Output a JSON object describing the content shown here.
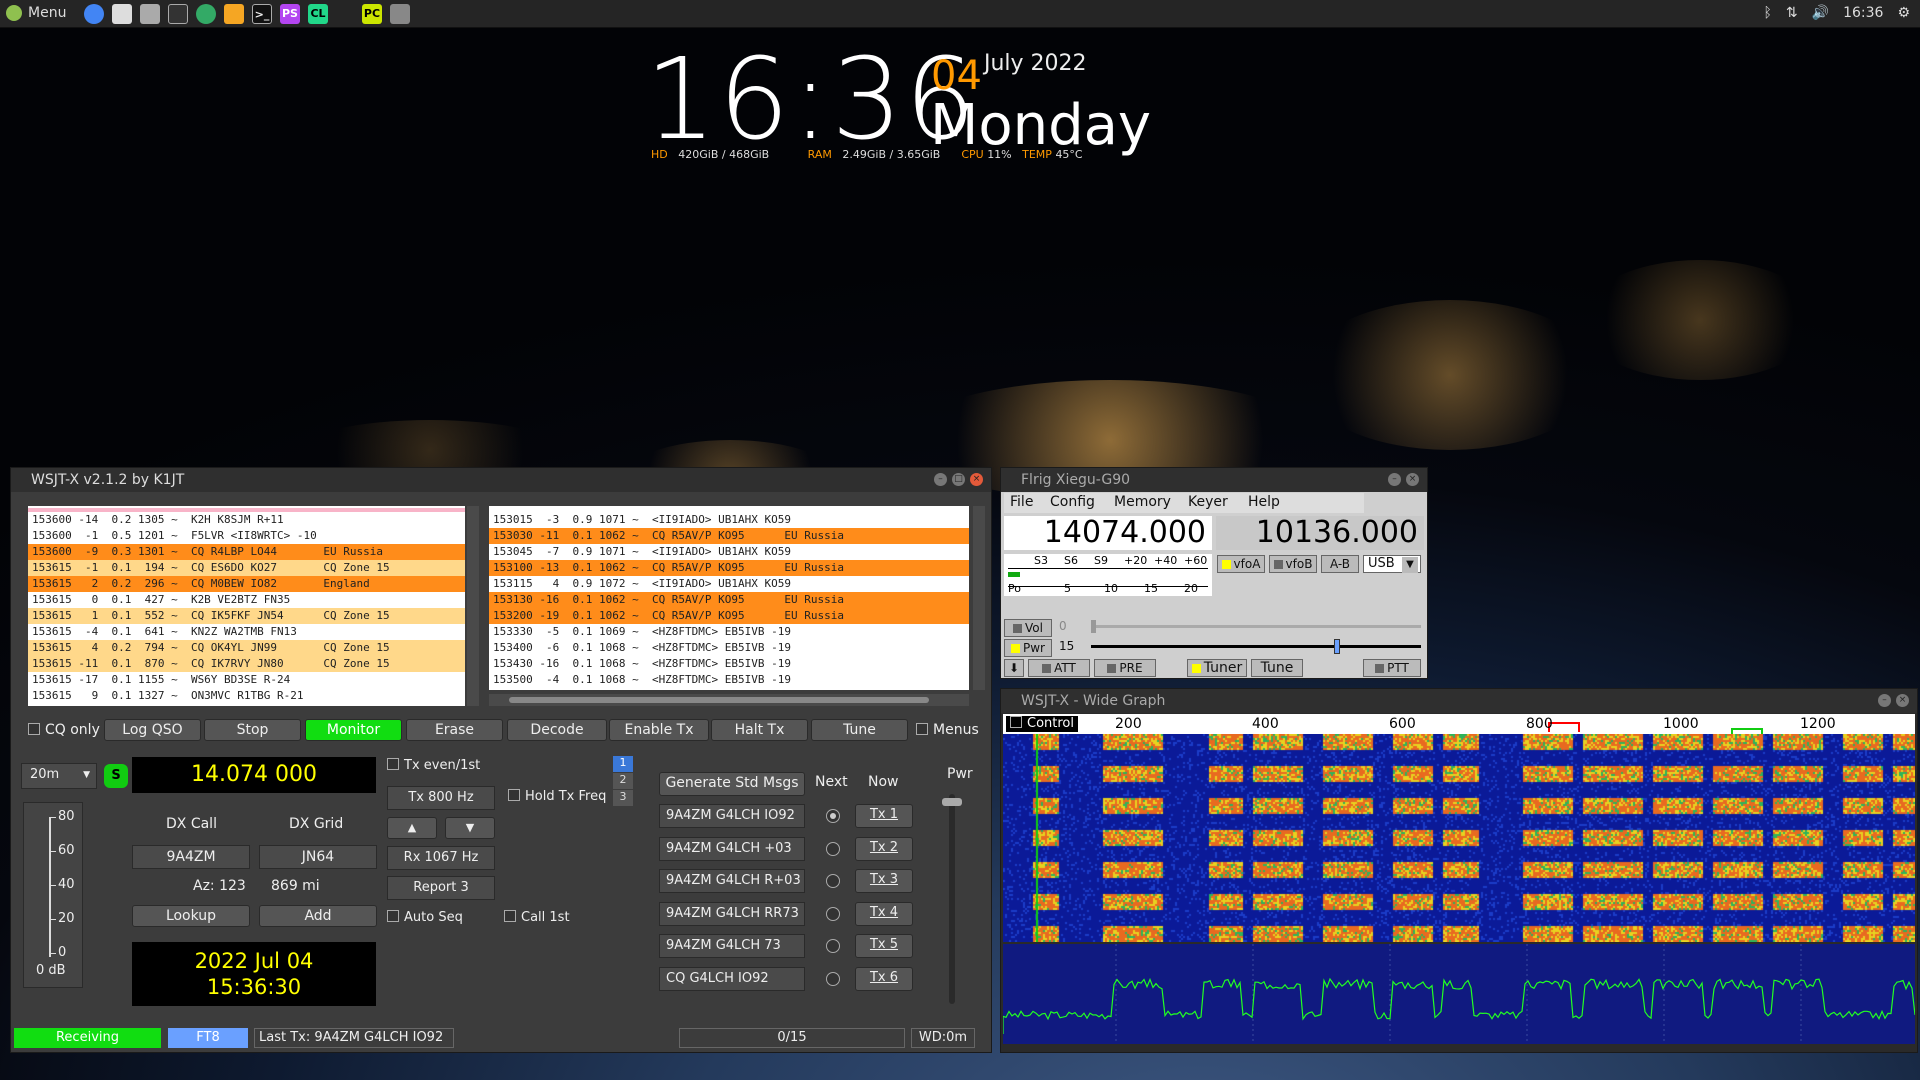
{
  "taskbar": {
    "menu_label": "Menu",
    "clock": "16:36"
  },
  "conky": {
    "time": "16:36",
    "day": "04",
    "month_year": "July 2022",
    "weekday": "Monday",
    "hd_label": "HD",
    "hd_value": "420GiB / 468GiB",
    "ram_label": "RAM",
    "ram_value": "2.49GiB / 3.65GiB",
    "cpu_label": "CPU",
    "cpu_value": "11%",
    "temp_label": "TEMP",
    "temp_value": "45°C"
  },
  "wsjtx": {
    "title": "WSJT-X  v2.1.2  by K1JT",
    "band_activity": [
      {
        "text": "153600 -14  0.2 1305 ~  K2H K8SJM R+11",
        "hl": ""
      },
      {
        "text": "153600  -1  0.5 1201 ~  F5LVR <II8WRTC> -10",
        "hl": ""
      },
      {
        "text": "153600  -9  0.3 1301 ~  CQ R4LBP LO44       EU Russia",
        "hl": "orange"
      },
      {
        "text": "153615  -1  0.1  194 ~  CQ ES6DO KO27       CQ Zone 15",
        "hl": "yellow"
      },
      {
        "text": "153615   2  0.2  296 ~  CQ M0BEW IO82       England",
        "hl": "orange"
      },
      {
        "text": "153615   0  0.1  427 ~  K2B VE2BTZ FN35",
        "hl": ""
      },
      {
        "text": "153615   1  0.1  552 ~  CQ IK5FKF JN54      CQ Zone 15",
        "hl": "yellow"
      },
      {
        "text": "153615  -4  0.1  641 ~  KN2Z WA2TMB FN13",
        "hl": ""
      },
      {
        "text": "153615   4  0.2  794 ~  CQ OK4YL JN99       CQ Zone 15",
        "hl": "yellow"
      },
      {
        "text": "153615 -11  0.1  870 ~  CQ IK7RVY JN80      CQ Zone 15",
        "hl": "yellow"
      },
      {
        "text": "153615 -17  0.1 1155 ~  WS6Y BD3SE R-24",
        "hl": ""
      },
      {
        "text": "153615   9  0.1 1327 ~  ON3MVC R1TBG R-21",
        "hl": ""
      }
    ],
    "rx_frequency": [
      {
        "text": "153015  -3  0.9 1071 ~  <II9IADO> UB1AHX KO59",
        "hl": ""
      },
      {
        "text": "153030 -11  0.1 1062 ~  CQ R5AV/P KO95      EU Russia",
        "hl": "orange"
      },
      {
        "text": "153045  -7  0.9 1071 ~  <II9IADO> UB1AHX KO59",
        "hl": ""
      },
      {
        "text": "153100 -13  0.1 1062 ~  CQ R5AV/P KO95      EU Russia",
        "hl": "orange"
      },
      {
        "text": "153115   4  0.9 1072 ~  <II9IADO> UB1AHX KO59",
        "hl": ""
      },
      {
        "text": "153130 -16  0.1 1062 ~  CQ R5AV/P KO95      EU Russia",
        "hl": "orange"
      },
      {
        "text": "153200 -19  0.1 1062 ~  CQ R5AV/P KO95      EU Russia",
        "hl": "orange"
      },
      {
        "text": "153330  -5  0.1 1069 ~  <HZ8FTDMC> EB5IVB -19",
        "hl": ""
      },
      {
        "text": "153400  -6  0.1 1068 ~  <HZ8FTDMC> EB5IVB -19",
        "hl": ""
      },
      {
        "text": "153430 -16  0.1 1068 ~  <HZ8FTDMC> EB5IVB -19",
        "hl": ""
      },
      {
        "text": "153500  -4  0.1 1068 ~  <HZ8FTDMC> EB5IVB -19",
        "hl": ""
      }
    ],
    "cq_only": "CQ only",
    "buttons": {
      "log_qso": "Log QSO",
      "stop": "Stop",
      "monitor": "Monitor",
      "erase": "Erase",
      "decode": "Decode",
      "enable_tx": "Enable Tx",
      "halt_tx": "Halt Tx",
      "tune": "Tune"
    },
    "menus": "Menus",
    "band": "20m",
    "s_badge": "S",
    "dial_freq": "14.074 000",
    "meter_ticks": [
      "80",
      "60",
      "40",
      "20",
      "0"
    ],
    "meter_db": "0 dB",
    "dx_call_label": "DX Call",
    "dx_grid_label": "DX Grid",
    "dx_call": "9A4ZM",
    "dx_grid": "JN64",
    "az": "Az: 123",
    "distance": "869 mi",
    "lookup": "Lookup",
    "add": "Add",
    "date": "2022 Jul 04",
    "time": "15:36:30",
    "tx_even": "Tx even/1st",
    "tx_freq": "Tx  800  Hz",
    "hold_tx_freq": "Hold Tx Freq",
    "rx_freq": "Rx  1067  Hz",
    "report": "Report 3",
    "auto_seq": "Auto Seq",
    "call_1st": "Call 1st",
    "tab1": "1",
    "tab2": "2",
    "tab3": "3",
    "gen_std_msgs": "Generate Std Msgs",
    "next_label": "Next",
    "now_label": "Now",
    "pwr_label": "Pwr",
    "messages": [
      {
        "msg": "9A4ZM G4LCH IO92",
        "tx": "Tx 1"
      },
      {
        "msg": "9A4ZM G4LCH +03",
        "tx": "Tx 2"
      },
      {
        "msg": "9A4ZM G4LCH R+03",
        "tx": "Tx 3"
      },
      {
        "msg": "9A4ZM G4LCH RR73",
        "tx": "Tx 4"
      },
      {
        "msg": "9A4ZM G4LCH 73",
        "tx": "Tx 5"
      },
      {
        "msg": "CQ G4LCH IO92",
        "tx": "Tx 6"
      }
    ],
    "status": {
      "receiving": "Receiving",
      "mode": "FT8",
      "last_tx": "Last Tx: 9A4ZM G4LCH IO92",
      "progress": "0/15",
      "wd": "WD:0m"
    }
  },
  "flrig": {
    "title": "Flrig Xiegu-G90",
    "menu": [
      "File",
      "Config",
      "Memory",
      "Keyer",
      "Help"
    ],
    "vfo_a": "14074.000",
    "vfo_b": "10136.000",
    "s_scale": [
      "S3",
      "S6",
      "S9",
      "+20",
      "+40",
      "+60"
    ],
    "po_scale": [
      "Po",
      "5",
      "10",
      "15",
      "20"
    ],
    "btn_vfoa": "vfoA",
    "btn_vfob": "vfoB",
    "btn_ab": "A-B",
    "mode": "USB",
    "vol_label": "Vol",
    "vol_value": "0",
    "pwr_label": "Pwr",
    "pwr_value": "15",
    "att": "ATT",
    "pre": "PRE",
    "tuner": "Tuner",
    "tune": "Tune",
    "ptt": "PTT"
  },
  "widegraph": {
    "title": "WSJT-X - Wide Graph",
    "control": "Control",
    "freq_ticks": [
      "200",
      "400",
      "600",
      "800",
      "1000",
      "1200"
    ]
  }
}
